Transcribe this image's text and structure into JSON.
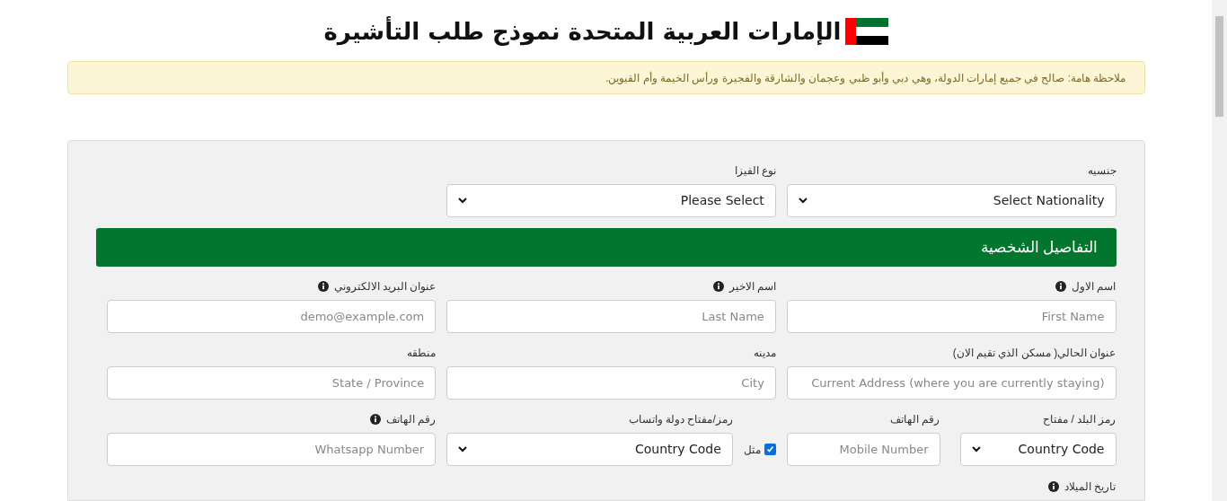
{
  "title": "الإمارات العربية المتحدة نموذج طلب التأشيرة",
  "notice": "ملاحظة هامة: صالح في جميع إمارات الدولة، وهي دبي وأبو ظبي وعجمان والشارقة والفجيرة ورأس الخيمة وأم القيوين.",
  "visa_fields": [
    {
      "kind": "select",
      "label": "جنسيه",
      "info": false,
      "value": "Select Nationality"
    },
    {
      "kind": "select",
      "label": "نوع الفيزا",
      "info": false,
      "value": "Please Select"
    }
  ],
  "section_title": "التفاصيل الشخصية",
  "personal_rows": [
    [
      {
        "kind": "input",
        "label": "اسم الاول",
        "info": true,
        "placeholder": "First Name"
      },
      {
        "kind": "input",
        "label": "اسم الاخير",
        "info": true,
        "placeholder": "Last Name"
      },
      {
        "kind": "input",
        "label": "عنوان البريد الالكتروني",
        "info": true,
        "placeholder": "demo@example.com"
      }
    ],
    [
      {
        "kind": "input",
        "label": "عنوان الحالي( مسكن الذي تقيم الان)",
        "info": false,
        "placeholder": "Current Address (where you are currently staying)"
      },
      {
        "kind": "input",
        "label": "مدينه",
        "info": false,
        "placeholder": "City"
      },
      {
        "kind": "input",
        "label": "منطقه",
        "info": false,
        "placeholder": "State / Province"
      }
    ],
    [
      {
        "kind": "pair",
        "parts": [
          {
            "kind": "select",
            "label": "رمز البلد / مفتاح",
            "info": false,
            "value": "Country Code"
          },
          {
            "kind": "input",
            "label": "رقم الهاتف",
            "info": false,
            "placeholder": "Mobile Number"
          }
        ]
      },
      {
        "kind": "same",
        "checkbox": {
          "label": "مثل",
          "checked": true
        },
        "field": {
          "kind": "select",
          "label": "رمز/مفتاح دولة واتساب",
          "info": false,
          "value": "Country Code"
        }
      },
      {
        "kind": "input",
        "label": "رقم الهاتف",
        "info": true,
        "placeholder": "Whatsapp Number"
      }
    ]
  ],
  "birth_date": {
    "label": "تاريخ الميلاد",
    "info": true
  }
}
